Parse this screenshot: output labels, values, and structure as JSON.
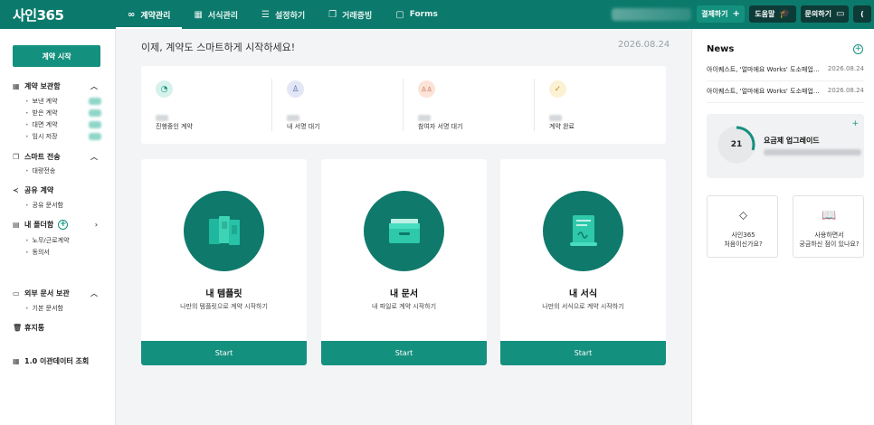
{
  "app": {
    "logo": "사인365"
  },
  "nav": [
    {
      "label": "계약관리",
      "icon": "∞",
      "active": true
    },
    {
      "label": "서식관리",
      "icon": "▦"
    },
    {
      "label": "설정하기",
      "icon": "☰"
    },
    {
      "label": "거래증빙",
      "icon": "❐"
    },
    {
      "label": "Forms",
      "icon": "▢"
    }
  ],
  "top_buttons": {
    "pay": "결제하기",
    "pay_icon": "+",
    "help": "도움말",
    "help_icon": "🎓",
    "ask": "문의하기",
    "ask_icon": "▭",
    "extra": "("
  },
  "sidebar": {
    "start": "계약 시작",
    "contracts": {
      "title": "계약 보관함",
      "items": [
        "보낸 계약",
        "받은 계약",
        "대면 계약",
        "임시 저장"
      ]
    },
    "smart": {
      "title": "스마트 전송",
      "items": [
        "대량전송"
      ]
    },
    "share": {
      "title": "공유 계약",
      "items": [
        "공유 문서함"
      ]
    },
    "folder": {
      "title": "내 폴더함",
      "items": [
        "노무/근로계약",
        "동의서"
      ]
    },
    "external": {
      "title": "외부 문서 보관",
      "items": [
        "기본 문서함"
      ]
    },
    "trash": "휴지통",
    "legacy": "1.0 이관데이터 조회"
  },
  "main": {
    "welcome": "이제, 계약도 스마트하게 시작하세요!",
    "date": "2026.08.24",
    "status": [
      {
        "label": "진행중인 계약",
        "icon": "◔",
        "bg": "#d7f2ec",
        "fg": "#14907f"
      },
      {
        "label": "내 서명 대기",
        "icon": "♙",
        "bg": "#e3e6f5",
        "fg": "#5b6aa8"
      },
      {
        "label": "참여자 서명 대기",
        "icon": "♙♙",
        "bg": "#fbe3d8",
        "fg": "#c9693f"
      },
      {
        "label": "계약 완료",
        "icon": "✓",
        "bg": "#fbf1d3",
        "fg": "#b98d1c"
      }
    ],
    "cards": [
      {
        "title": "내 템플릿",
        "desc": "나만의 템플릿으로 계약 시작하기",
        "button": "Start"
      },
      {
        "title": "내 문서",
        "desc": "내 파일로 계약 시작하기",
        "button": "Start"
      },
      {
        "title": "내 서식",
        "desc": "나만의 서식으로 계약 시작하기",
        "button": "Start"
      }
    ]
  },
  "right": {
    "news_title": "News",
    "news": [
      {
        "text": "아이퀘스트, '얼마에요 Works' 도소매업서비스 출시",
        "date": "2026.08.24"
      },
      {
        "text": "아이퀘스트, '얼마에요 Works' 도소매업서비스 출시",
        "date": "2026.08.24"
      }
    ],
    "plan": {
      "number": "21",
      "title": "요금제 업그레이드",
      "progress": 0.3
    },
    "help": [
      {
        "icon": "⬦",
        "line1": "사인365",
        "line2": "처음이신가요?"
      },
      {
        "icon": "📖",
        "line1": "사용하면서",
        "line2": "궁금하신 점이 있나요?"
      }
    ]
  },
  "colors": {
    "brand": "#0b7a6c",
    "accent": "#14907f",
    "dark": "#0d3b37"
  }
}
